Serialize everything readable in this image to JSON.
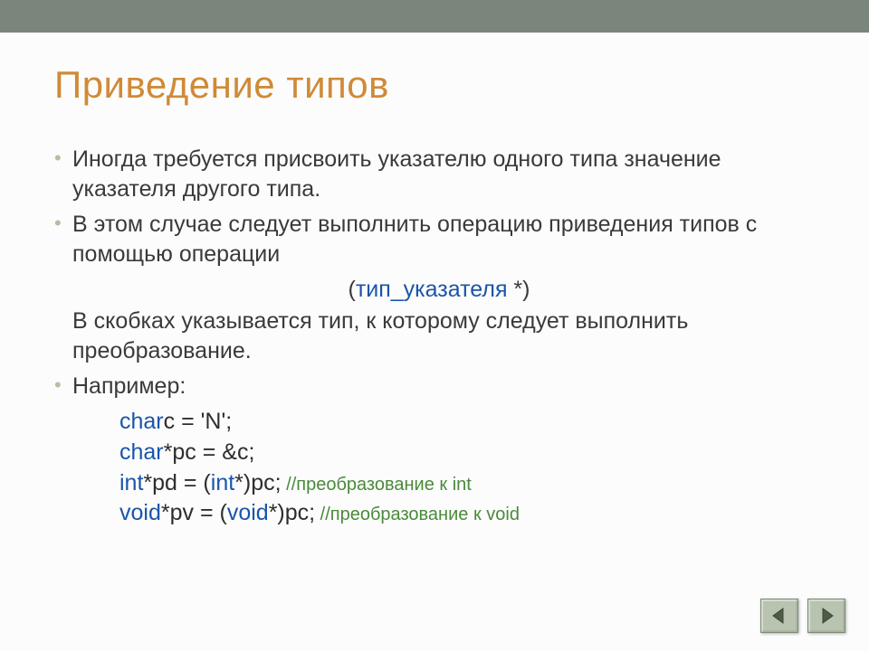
{
  "title": "Приведение типов",
  "bullets": {
    "b1": "Иногда требуется присвоить указателю одного типа значение указателя другого типа.",
    "b2": "В этом случае следует выполнить операцию приведения типов с помощью операции",
    "b3": "Например:"
  },
  "syntax": {
    "open": "(",
    "token": "тип_указателя",
    "close": " *)"
  },
  "explain": "В скобках указывается тип, к которому следует выполнить преобразование.",
  "code": {
    "l1": {
      "kw": "char",
      "rest": "с = 'N';"
    },
    "l2": {
      "kw": "char",
      "rest": "*pc = &c;"
    },
    "l3": {
      "kw1": "int",
      "mid": "*pd = (",
      "kw2": "int",
      "rest": "*)pc;",
      "comment": " //преобразование к int"
    },
    "l4": {
      "kw1": "void",
      "mid": "*pv = (",
      "kw2": "void",
      "rest": "*)pc;",
      "comment": " //преобразование к void"
    }
  },
  "nav": {
    "prev": "previous-slide",
    "next": "next-slide"
  }
}
